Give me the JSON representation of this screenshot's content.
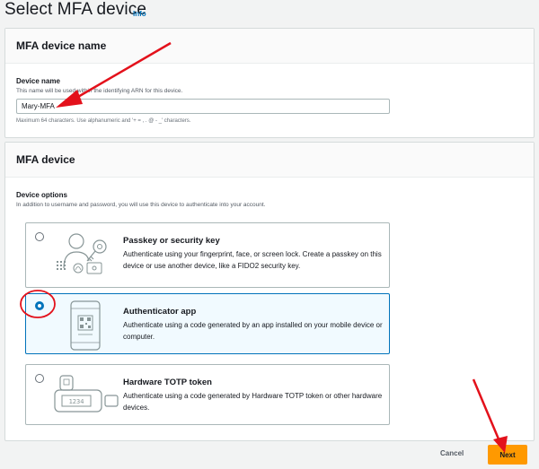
{
  "page": {
    "title": "Select MFA device",
    "info": "Info"
  },
  "name_section": {
    "header": "MFA device name",
    "label": "Device name",
    "description": "This name will be used within the identifying ARN for this device.",
    "value": "Mary-MFA",
    "constraint": "Maximum 64 characters. Use alphanumeric and '+ = , . @ - _' characters."
  },
  "device_section": {
    "header": "MFA device",
    "label": "Device options",
    "description": "In addition to username and password, you will use this device to authenticate into your account.",
    "options": [
      {
        "title": "Passkey or security key",
        "desc": "Authenticate using your fingerprint, face, or screen lock. Create a passkey on this device or use another device, like a FIDO2 security key.",
        "selected": false
      },
      {
        "title": "Authenticator app",
        "desc": "Authenticate using a code generated by an app installed on your mobile device or computer.",
        "selected": true
      },
      {
        "title": "Hardware TOTP token",
        "desc": "Authenticate using a code generated by Hardware TOTP token or other hardware devices.",
        "selected": false,
        "token_display": "1234"
      }
    ]
  },
  "footer": {
    "cancel": "Cancel",
    "next": "Next"
  },
  "colors": {
    "accent": "#0073bb",
    "primary_button": "#ff9900",
    "annotation": "#e3111b"
  }
}
